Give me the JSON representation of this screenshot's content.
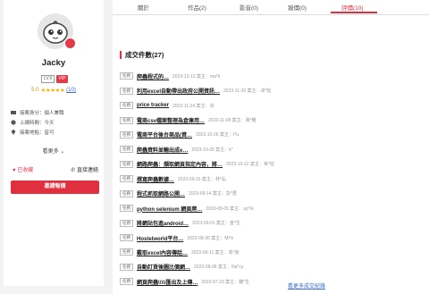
{
  "profile": {
    "name": "Jacky",
    "level": "LV.6",
    "vip": "VIP",
    "rating": "5.0",
    "stars": "★★★★★",
    "review_count": "(10)",
    "info": [
      {
        "icon": "id-card-icon",
        "text": "接案身分：個人兼職"
      },
      {
        "icon": "clock-icon",
        "text": "上線時間：今天"
      },
      {
        "icon": "location-icon",
        "text": "接案地點：皆可"
      }
    ],
    "more_label": "看更多 ⌄",
    "favorited_label": "已收藏",
    "contact_label": "直接連絡",
    "invite_label": "邀請報價"
  },
  "tabs": [
    {
      "label": "關於",
      "active": false
    },
    {
      "label": "作品(2)",
      "active": false
    },
    {
      "label": "影音(0)",
      "active": false
    },
    {
      "label": "報價(0)",
      "active": false
    },
    {
      "label": "評價(10)",
      "active": true
    }
  ],
  "section_title": "成交件數(27)",
  "deals": [
    {
      "tag": "任務",
      "title": "爬蟲程式的…",
      "meta": "2023-12-13 案主：ma*k"
    },
    {
      "tag": "任務",
      "title": "利用excel自動帶出政府公開資訊…",
      "meta": "2023-11-30 案主：卓*廷"
    },
    {
      "tag": "任務",
      "title": "price tracker",
      "meta": "2023-11-24 案主：宗"
    },
    {
      "tag": "任務",
      "title": "電商csv檔案整理為倉庫用…",
      "meta": "2023-11-08 案主：黃*耀"
    },
    {
      "tag": "任務",
      "title": "電商平台後台商品(資…",
      "meta": "2023-10-26 案主：t*u"
    },
    {
      "tag": "任務",
      "title": "爬蟲資料並輸出成e…",
      "meta": "2023-10-25 案主：k*"
    },
    {
      "tag": "任務",
      "title": "網路爬蟲：擷取網頁指定內容，將…",
      "meta": "2023-10-12 案主：吳*廷"
    },
    {
      "tag": "任務",
      "title": "撰寫爬蟲數據…",
      "meta": "2023-09-15 案主：林*弘"
    },
    {
      "tag": "任務",
      "title": "程式抓取網路公開…",
      "meta": "2023-09-14 案主：彭*君"
    },
    {
      "tag": "任務",
      "title": "python selenium 網頁爬…",
      "meta": "2023-09-05 案主：sp*rk"
    },
    {
      "tag": "任務",
      "title": "將網站包進android…",
      "meta": "2023-09-01 案主：金*生"
    },
    {
      "tag": "任務",
      "title": "Hostelworld平台…",
      "meta": "2023-08-30 案主：Mi*e"
    },
    {
      "tag": "任務",
      "title": "戴取excel內容傳話…",
      "meta": "2023-08-11 案主：高*良"
    },
    {
      "tag": "任務",
      "title": "自動訂貨後圖比價網…",
      "meta": "2023-08-08 案主：Na*cy"
    },
    {
      "tag": "任務",
      "title": "網頁爬蟲\\\\\\\\\\匯出及上傳…",
      "meta": "2023-07-23 案主：鍾*生"
    }
  ],
  "more_link": "看更多成交紀錄",
  "colors": {
    "accent": "#e0303f",
    "link": "#3b6cc8"
  }
}
